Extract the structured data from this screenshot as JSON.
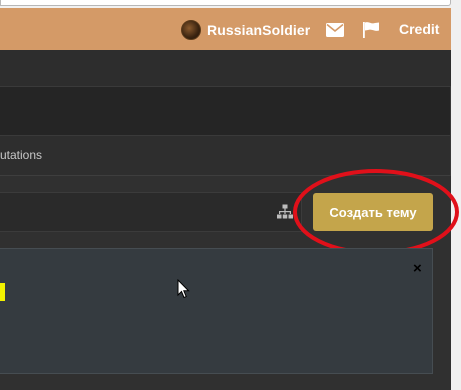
{
  "topbar": {
    "username": "RussianSoldier",
    "credit_label": "Credit",
    "background": "#d49a67",
    "icons": [
      "avatar",
      "envelope-icon",
      "flag-icon"
    ]
  },
  "tabs": {
    "partial_label": "utations"
  },
  "toolbar": {
    "create_topic_label": "Создать тему",
    "button_color": "#c4a54b",
    "icons": [
      "sitemap-icon"
    ]
  },
  "notice": {
    "close_label": "×",
    "highlight_color": "#f2f200"
  },
  "annotation": {
    "shape": "ellipse",
    "color": "#e0101a"
  }
}
